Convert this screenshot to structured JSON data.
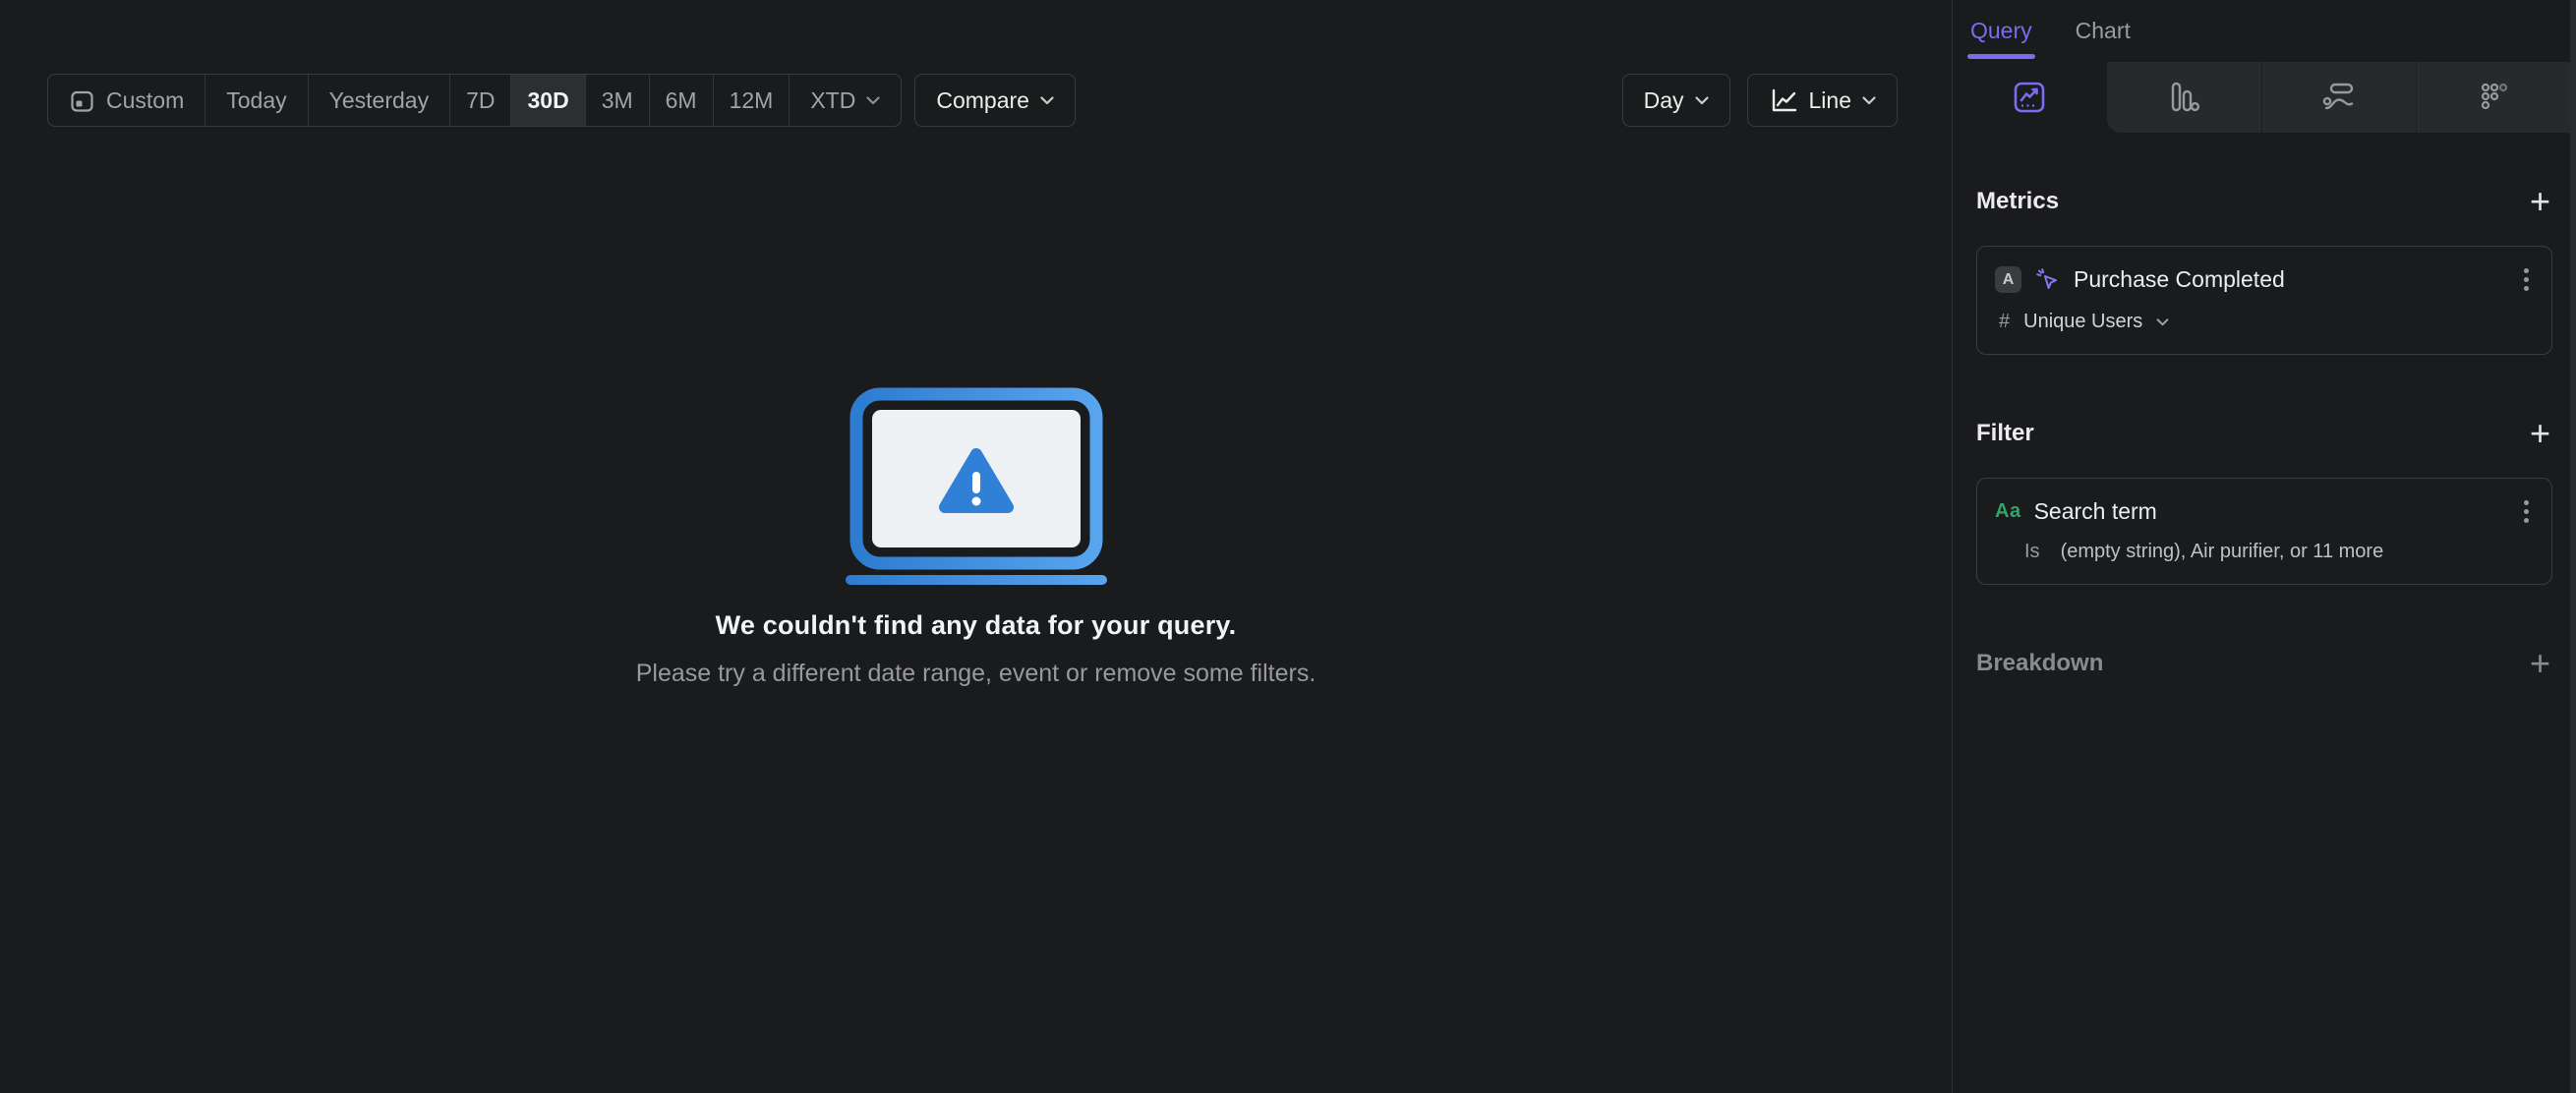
{
  "colors": {
    "bg": "#1a1b1c",
    "panel_border": "#2f3032",
    "strip_bg": "#28292c",
    "accent": "#7d6af0",
    "event_purple": "#8678f2",
    "green": "#36a269",
    "blue_dark": "#2e7cd0",
    "blue_light": "#58a4ee",
    "triangle_blue": "#2f80d6",
    "screen": "#edf1f4"
  },
  "toolbar": {
    "date_ranges": [
      {
        "label": "Custom"
      },
      {
        "label": "Today"
      },
      {
        "label": "Yesterday"
      },
      {
        "label": "7D"
      },
      {
        "label": "30D",
        "selected": true
      },
      {
        "label": "3M"
      },
      {
        "label": "6M"
      },
      {
        "label": "12M"
      },
      {
        "label": "XTD"
      }
    ],
    "compare_label": "Compare",
    "granularity_label": "Day",
    "chart_type_label": "Line"
  },
  "empty_state": {
    "title": "We couldn't find any data for your query.",
    "subtitle": "Please try a different date range, event or remove some filters."
  },
  "sidebar": {
    "tabs": [
      {
        "label": "Query"
      },
      {
        "label": "Chart"
      }
    ],
    "icon_tabs": [
      {
        "name": "insights",
        "active": true
      },
      {
        "name": "funnels"
      },
      {
        "name": "flows"
      },
      {
        "name": "retention"
      }
    ],
    "metrics": {
      "header": "Metrics",
      "add_label": "+",
      "card": {
        "series_letter": "A",
        "event_name": "Purchase Completed",
        "aggregation_symbol": "#",
        "aggregation": "Unique Users"
      }
    },
    "filter": {
      "header": "Filter",
      "add_label": "+",
      "card": {
        "property_type": "Aa",
        "property_name": "Search term",
        "operator": "Is",
        "values_summary": "(empty string), Air purifier, or 11 more"
      }
    },
    "breakdown": {
      "header": "Breakdown",
      "add_label": "+"
    }
  }
}
